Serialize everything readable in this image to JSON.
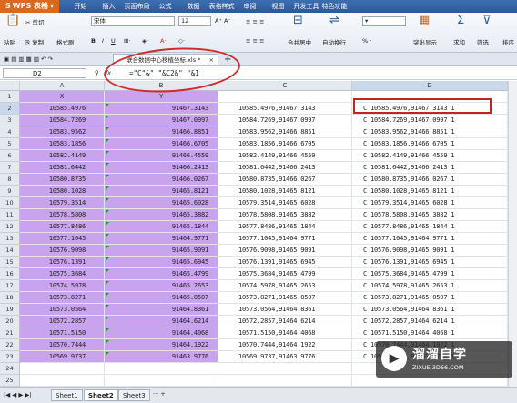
{
  "app": {
    "name": "WPS 表格",
    "menus": [
      "开始",
      "插入",
      "页面布局",
      "公式",
      "数据",
      "表格样式",
      "审阅",
      "视图",
      "开发工具",
      "特色功能"
    ]
  },
  "ribbon": {
    "cut": "剪切",
    "paste": "粘贴",
    "copy": "复制",
    "format_painter": "格式刷",
    "font": "宋体",
    "size": "12",
    "merge": "合并居中",
    "wrap": "自动换行",
    "percent": "% ·",
    "highlight": "突出显示",
    "sum": "求和",
    "filter": "筛选",
    "sort": "排序"
  },
  "doc_tab": {
    "name": "联合数据中心移植坐标.xls *"
  },
  "formula_bar": {
    "name_box": "D2",
    "fx": "fx",
    "formula": "=\"C\"&\" \"&C2&\" \"&1"
  },
  "columns": [
    {
      "id": "A",
      "label": "A",
      "header": "X"
    },
    {
      "id": "B",
      "label": "B",
      "header": "Y"
    },
    {
      "id": "C",
      "label": "C",
      "header": ""
    },
    {
      "id": "D",
      "label": "D",
      "header": ""
    }
  ],
  "rows": [
    {
      "n": "2",
      "x": "10585.4976",
      "y": "91467.3143",
      "c": "10585.4976,91467.3143",
      "d": "C 10585.4976,91467.3143 1"
    },
    {
      "n": "3",
      "x": "10584.7269",
      "y": "91467.0997",
      "c": "10584.7269,91467.0997",
      "d": "C 10584.7269,91467.0997 1"
    },
    {
      "n": "4",
      "x": "10583.9562",
      "y": "91466.8851",
      "c": "10583.9562,91466.8851",
      "d": "C 10583.9562,91466.8851 1"
    },
    {
      "n": "5",
      "x": "10583.1856",
      "y": "91466.6705",
      "c": "10583.1856,91466.6705",
      "d": "C 10583.1856,91466.6705 1"
    },
    {
      "n": "6",
      "x": "10582.4149",
      "y": "91466.4559",
      "c": "10582.4149,91466.4559",
      "d": "C 10582.4149,91466.4559 1"
    },
    {
      "n": "7",
      "x": "10581.6442",
      "y": "91466.2413",
      "c": "10581.6442,91466.2413",
      "d": "C 10581.6442,91466.2413 1"
    },
    {
      "n": "8",
      "x": "10580.8735",
      "y": "91466.0267",
      "c": "10580.8735,91466.0267",
      "d": "C 10580.8735,91466.0267 1"
    },
    {
      "n": "9",
      "x": "10580.1028",
      "y": "91465.8121",
      "c": "10580.1028,91465.8121",
      "d": "C 10580.1028,91465.8121 1"
    },
    {
      "n": "10",
      "x": "10579.3514",
      "y": "91465.6028",
      "c": "10579.3514,91465.6028",
      "d": "C 10579.3514,91465.6028 1"
    },
    {
      "n": "11",
      "x": "10578.5808",
      "y": "91465.3882",
      "c": "10578.5808,91465.3882",
      "d": "C 10578.5808,91465.3882 1"
    },
    {
      "n": "12",
      "x": "10577.8486",
      "y": "91465.1844",
      "c": "10577.8486,91465.1844",
      "d": "C 10577.8486,91465.1844 1"
    },
    {
      "n": "13",
      "x": "10577.1045",
      "y": "91464.9771",
      "c": "10577.1045,91464.9771",
      "d": "C 10577.1045,91464.9771 1"
    },
    {
      "n": "14",
      "x": "10576.9098",
      "y": "91465.9091",
      "c": "10576.9098,91465.9091",
      "d": "C 10576.9098,91465.9091 1"
    },
    {
      "n": "15",
      "x": "10576.1391",
      "y": "91465.6945",
      "c": "10576.1391,91465.6945",
      "d": "C 10576.1391,91465.6945 1"
    },
    {
      "n": "16",
      "x": "10575.3684",
      "y": "91465.4799",
      "c": "10575.3684,91465.4799",
      "d": "C 10575.3684,91465.4799 1"
    },
    {
      "n": "17",
      "x": "10574.5978",
      "y": "91465.2653",
      "c": "10574.5978,91465.2653",
      "d": "C 10574.5978,91465.2653 1"
    },
    {
      "n": "18",
      "x": "10573.8271",
      "y": "91465.0507",
      "c": "10573.8271,91465.0507",
      "d": "C 10573.8271,91465.0507 1"
    },
    {
      "n": "19",
      "x": "10573.0564",
      "y": "91464.8361",
      "c": "10573.0564,91464.8361",
      "d": "C 10573.0564,91464.8361 1"
    },
    {
      "n": "20",
      "x": "10572.2857",
      "y": "91464.6214",
      "c": "10572.2857,91464.6214",
      "d": "C 10572.2857,91464.6214 1"
    },
    {
      "n": "21",
      "x": "10571.5150",
      "y": "91464.4068",
      "c": "10571.5150,91464.4068",
      "d": "C 10571.5150,91464.4068 1"
    },
    {
      "n": "22",
      "x": "10570.7444",
      "y": "91464.1922",
      "c": "10570.7444,91464.1922",
      "d": "C 10570.7444,91464.1922 1"
    },
    {
      "n": "23",
      "x": "10569.9737",
      "y": "91463.9776",
      "c": "10569.9737,91463.9776",
      "d": "C 10569.9737,91463.9776 1"
    },
    {
      "n": "24",
      "x": "",
      "y": "",
      "c": "",
      "d": ""
    },
    {
      "n": "25",
      "x": "",
      "y": "",
      "c": "",
      "d": ""
    }
  ],
  "sheets": [
    "Sheet1",
    "Sheet2",
    "Sheet3"
  ],
  "active_sheet": "Sheet2",
  "watermark": {
    "title": "溜溜自学",
    "url": "ZIXUE.3D66.COM"
  },
  "colors": {
    "purple": "#c9a3ee",
    "annotation_red": "#d42a2a",
    "menubar": "#2a5a9e",
    "appbtn": "#d9691f"
  }
}
